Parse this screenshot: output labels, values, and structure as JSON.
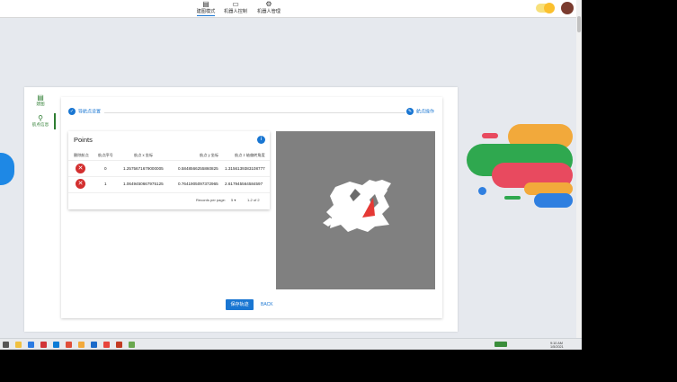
{
  "nav": {
    "items": [
      {
        "label": "建图模式",
        "icon": "map-icon"
      },
      {
        "label": "机器人控制",
        "icon": "gamepad-icon"
      },
      {
        "label": "机器人管理",
        "icon": "gear-icon"
      }
    ]
  },
  "sidebar": {
    "items": [
      {
        "label": "建图",
        "icon": "map-icon"
      },
      {
        "label": "航点信息",
        "icon": "location-pin-icon"
      }
    ]
  },
  "stepper": {
    "step1_label": "导航点设置",
    "step2_label": "航点操作"
  },
  "points": {
    "title": "Points",
    "info_icon": "info-icon",
    "headers": [
      "删除航点",
      "航点序号",
      "航点 x 坐标",
      "航点 y 坐标",
      "航点 z 轴偏转角度"
    ],
    "rows": [
      {
        "index": "0",
        "x": "1.2575671679000005",
        "y": "0.5848566255860825",
        "z": "1.3156139383108777"
      },
      {
        "index": "1",
        "x": "1.0649450667975125",
        "y": "0.7641905097372965",
        "z": "2.617945564584597"
      }
    ],
    "records_label": "Records per page:",
    "records_value": "5",
    "range": "1-2 of 2"
  },
  "actions": {
    "save_label": "保存轨迹",
    "back_label": "BACK"
  },
  "colors": {
    "accent": "#1976d2",
    "delete": "#d32f2f",
    "nav_green": "#2e7d32"
  },
  "taskbar": {
    "tray_time": "9:10 AM",
    "tray_date": "1/5/2021"
  }
}
